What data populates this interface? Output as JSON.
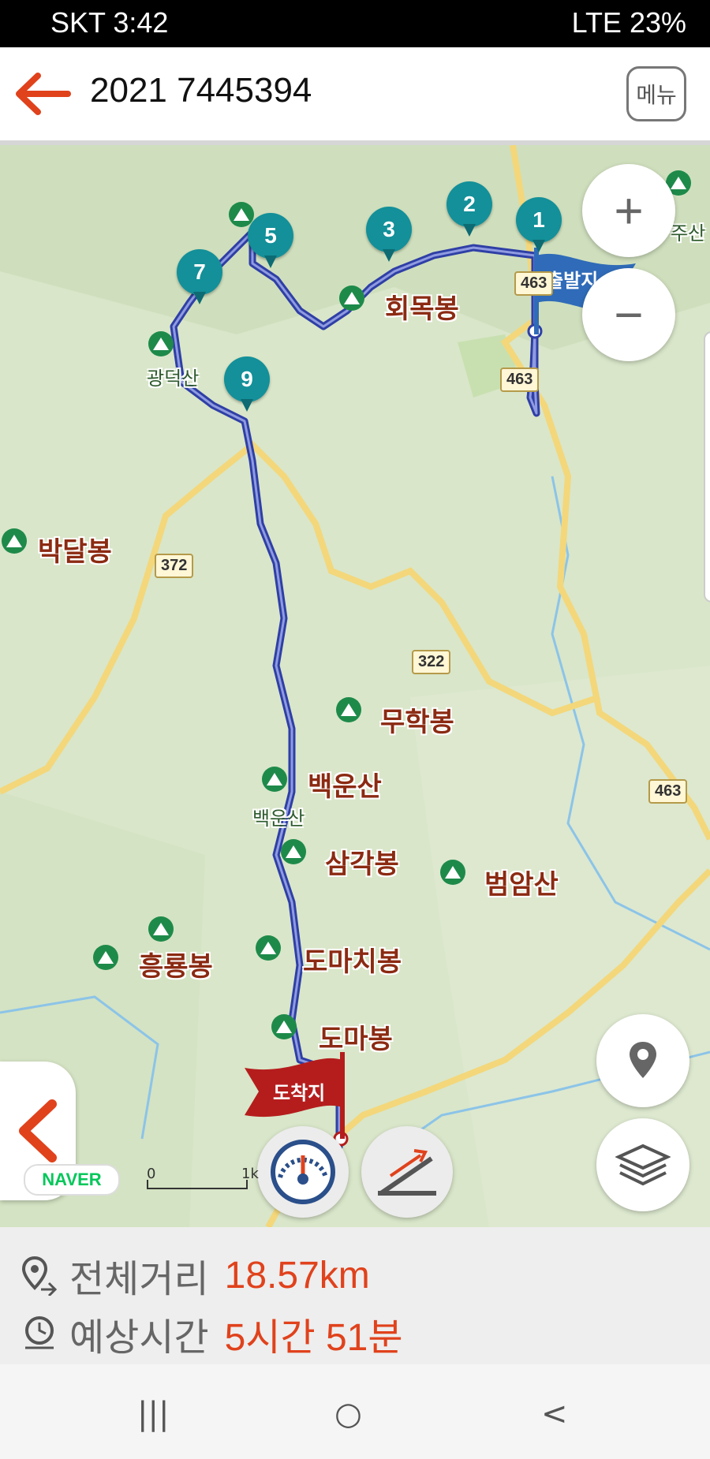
{
  "status_bar": {
    "left": "SKT 3:42",
    "right": "LTE 23%"
  },
  "app_bar": {
    "title": "2021 7445394",
    "menu_label": "메뉴",
    "back_icon": "back-arrow-icon"
  },
  "map": {
    "markers": [
      "1",
      "2",
      "3",
      "5",
      "7",
      "9"
    ],
    "start_flag": "출발지",
    "end_flag": "도착지",
    "place_labels": [
      "회목봉",
      "박달봉",
      "무학봉",
      "백운산",
      "삼각봉",
      "범암산",
      "흥룡봉",
      "도마치봉",
      "도마봉"
    ],
    "small_labels": [
      "광덕산",
      "백운산",
      "주산"
    ],
    "road_numbers": [
      "463",
      "372",
      "322",
      "463",
      "463"
    ],
    "naver_logo": "NAVER",
    "scale_start": "0",
    "scale_end": "1k",
    "colors": {
      "route": "#2f3fa6",
      "start_flag": "#2f6bb8",
      "end_flag": "#b51d1d",
      "marker": "#139099",
      "accent": "#e0421c"
    }
  },
  "summary": {
    "distance_label": "전체거리",
    "distance_value": "18.57km",
    "time_label": "예상시간",
    "time_value": "5시간 51분"
  },
  "nav_bar": {
    "recents": "|||",
    "home": "○",
    "back": "<"
  }
}
